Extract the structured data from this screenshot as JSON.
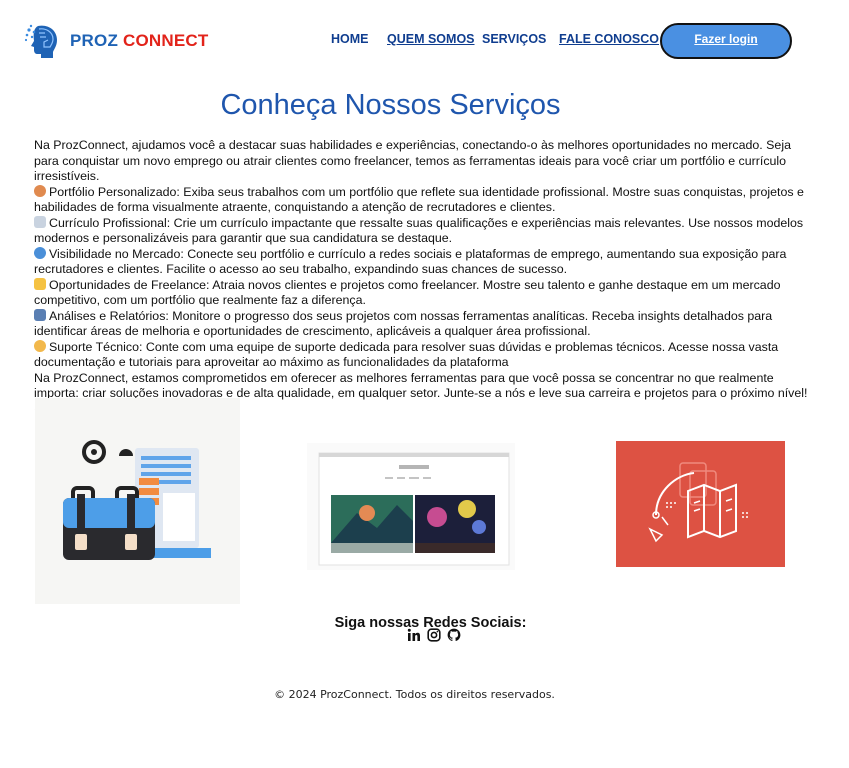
{
  "brand": {
    "part1": "PROZ",
    "part2": "CONNECT"
  },
  "nav": {
    "home": "HOME",
    "about": "QUEM SOMOS",
    "services": "SERVIÇOS",
    "contact": "FALE CONOSCO",
    "login": "Fazer login"
  },
  "page_title": "Conheça Nossos Serviços",
  "content": {
    "intro": "Na ProzConnect, ajudamos você a destacar suas habilidades e experiências, conectando-o às melhores oportunidades no mercado. Seja para conquistar um novo emprego ou atrair clientes como freelancer, temos as ferramentas ideais para você criar um portfólio e currículo irresistíveis.",
    "items": [
      {
        "icon": "palette-emoji",
        "text": "Portfólio Personalizado: Exiba seus trabalhos com um portfólio que reflete sua identidade profissional. Mostre suas conquistas, projetos e habilidades de forma visualmente atraente, conquistando a atenção de recrutadores e clientes."
      },
      {
        "icon": "document-emoji",
        "text": "Currículo Profissional: Crie um currículo impactante que ressalte suas qualificações e experiências mais relevantes. Use nossos modelos modernos e personalizáveis para garantir que sua candidatura se destaque."
      },
      {
        "icon": "globe-emoji",
        "text": "Visibilidade no Mercado: Conecte seu portfólio e currículo a redes sociais e plataformas de emprego, aumentando sua exposição para recrutadores e clientes. Facilite o acesso ao seu trabalho, expandindo suas chances de sucesso."
      },
      {
        "icon": "handshake-emoji",
        "text": "Oportunidades de Freelance: Atraia novos clientes e projetos como freelancer. Mostre seu talento e ganhe destaque em um mercado competitivo, com um portfólio que realmente faz a diferença."
      },
      {
        "icon": "bar-chart-emoji",
        "text": "Análises e Relatórios: Monitore o progresso dos seus projetos com nossas ferramentas analíticas. Receba insights detalhados para identificar áreas de melhoria e oportunidades de crescimento, aplicáveis a qualquer área profissional."
      },
      {
        "icon": "support-person-emoji",
        "text": "Suporte Técnico: Conte com uma equipe de suporte dedicada para resolver suas dúvidas e problemas técnicos. Acesse nossa vasta documentação e tutoriais para aproveitar ao máximo as funcionalidades da plataforma"
      }
    ],
    "closing": "Na ProzConnect, estamos comprometidos em oferecer as melhores ferramentas para que você possa se concentrar no que realmente importa: criar soluções inovadoras e de alta qualidade, em qualquer setor. Junte-se a nós e leve sua carreira e projetos para o próximo nível! 🚀"
  },
  "social": {
    "title": "Siga nossas Redes Sociais:"
  },
  "footer": "© 2024 ProzConnect. Todos os direitos reservados.",
  "colors": {
    "brand_blue": "#1f63b5",
    "brand_red": "#e2231a",
    "nav": "#0f3d8f",
    "button": "#4a90e2",
    "card_red": "#dd5243"
  }
}
